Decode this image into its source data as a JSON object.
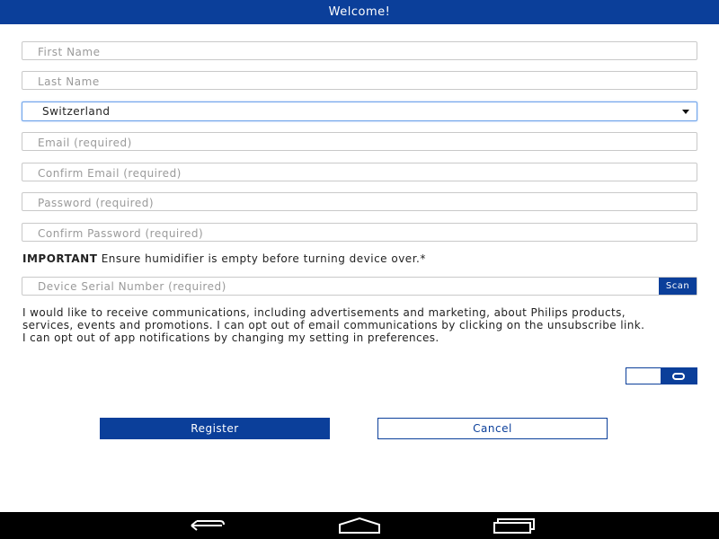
{
  "title": "Welcome!",
  "form": {
    "first_name_placeholder": "First Name",
    "last_name_placeholder": "Last Name",
    "country_value": "Switzerland",
    "email_placeholder": "Email (required)",
    "confirm_email_placeholder": "Confirm Email (required)",
    "password_placeholder": "Password (required)",
    "confirm_password_placeholder": "Confirm Password (required)",
    "important_label": "IMPORTANT",
    "important_text": " Ensure humidifier is empty before turning device over.*",
    "serial_placeholder": "Device Serial Number (required)",
    "scan_label": "Scan",
    "consent_text": "I would like to receive communications, including advertisements and marketing, about Philips products, services, events and promotions. I can opt out of email communications by clicking on the unsubscribe link. I can opt out of app notifications by changing my setting in preferences.",
    "consent_toggle_on": false
  },
  "buttons": {
    "register_label": "Register",
    "cancel_label": "Cancel"
  },
  "system_nav": {
    "icons": [
      "back-icon",
      "home-icon",
      "recent-apps-icon"
    ]
  },
  "colors": {
    "primary": "#0b3f9a",
    "focus_border": "#6ea3ea"
  }
}
